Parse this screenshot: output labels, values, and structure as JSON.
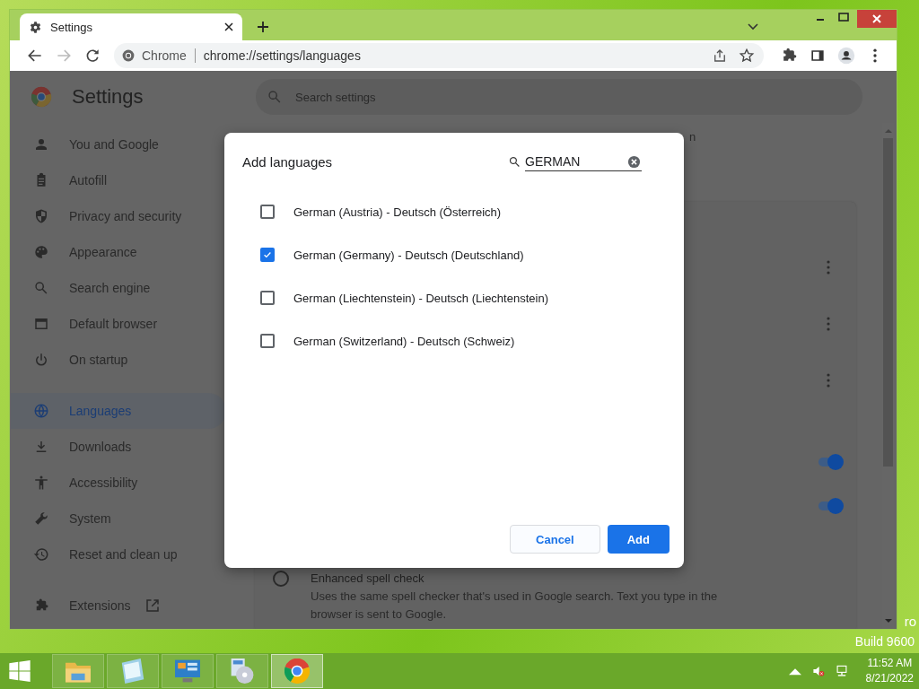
{
  "browser": {
    "tab": {
      "title": "Settings"
    },
    "address": {
      "site_label": "Chrome",
      "url": "chrome://settings/languages"
    }
  },
  "settings": {
    "title": "Settings",
    "search": {
      "placeholder": "Search settings"
    },
    "sidebar": {
      "items": [
        {
          "label": "You and Google",
          "selected": false
        },
        {
          "label": "Autofill",
          "selected": false
        },
        {
          "label": "Privacy and security",
          "selected": false
        },
        {
          "label": "Appearance",
          "selected": false
        },
        {
          "label": "Search engine",
          "selected": false
        },
        {
          "label": "Default browser",
          "selected": false
        },
        {
          "label": "On startup",
          "selected": false
        },
        {
          "label": "Languages",
          "selected": true
        },
        {
          "label": "Downloads",
          "selected": false
        },
        {
          "label": "Accessibility",
          "selected": false
        },
        {
          "label": "System",
          "selected": false
        },
        {
          "label": "Reset and clean up",
          "selected": false
        }
      ],
      "extensions": {
        "label": "Extensions"
      }
    },
    "partial_text": "n",
    "toggles": [
      {
        "on": true
      },
      {
        "on": true
      }
    ],
    "spell_option": {
      "selected": false,
      "label": "Enhanced spell check",
      "description": "Uses the same spell checker that's used in Google search. Text you type in the browser is sent to Google."
    }
  },
  "dialog": {
    "title": "Add languages",
    "search": {
      "value": "GERMAN"
    },
    "options": [
      {
        "label": "German (Austria) - Deutsch (Österreich)",
        "checked": false
      },
      {
        "label": "German (Germany) - Deutsch (Deutschland)",
        "checked": true
      },
      {
        "label": "German (Liechtenstein) - Deutsch (Liechtenstein)",
        "checked": false
      },
      {
        "label": "German (Switzerland) - Deutsch (Schweiz)",
        "checked": false
      }
    ],
    "buttons": {
      "cancel": "Cancel",
      "add": "Add"
    }
  },
  "desktop": {
    "build": "Build 9600",
    "edge_text": "ro"
  },
  "taskbar": {
    "apps": [
      {
        "kind": "folder",
        "selected": false
      },
      {
        "kind": "notepad",
        "selected": false
      },
      {
        "kind": "panel",
        "selected": false
      },
      {
        "kind": "installer",
        "selected": false
      },
      {
        "kind": "browser",
        "selected": true
      }
    ],
    "clock": {
      "time": "11:52 AM",
      "date": "8/21/2022"
    }
  }
}
